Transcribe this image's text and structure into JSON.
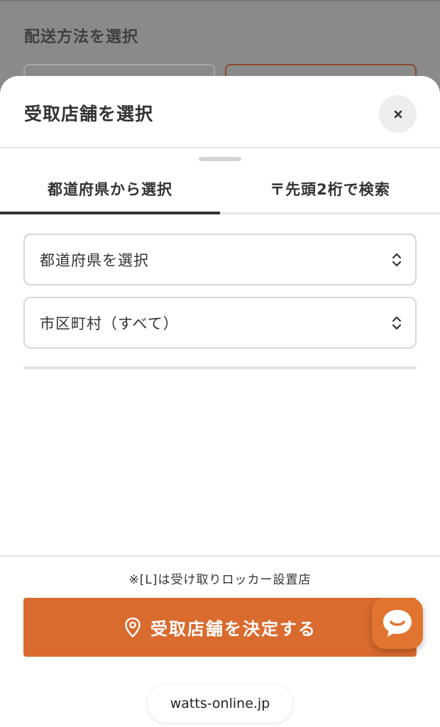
{
  "background": {
    "section_title": "配送方法を選択"
  },
  "sheet": {
    "title": "受取店舗を選択",
    "close_label": "×",
    "tabs": [
      {
        "label": "都道府県から選択",
        "active": true
      },
      {
        "label": "〒先頭2桁で検索",
        "active": false
      }
    ],
    "prefecture_select": {
      "value": "都道府県を選択"
    },
    "city_select": {
      "value": "市区町村（すべて）"
    },
    "note": "※[L]は受け取りロッカー設置店",
    "confirm_button": "受取店舗を決定する",
    "icons": {
      "confirm": "map-pin-icon",
      "select": "chevron-up-down-icon",
      "close": "close-icon",
      "chat": "chat-icon"
    }
  },
  "browser": {
    "url": "watts-online.jp"
  },
  "colors": {
    "accent": "#d96b2f",
    "chat": "#e1752f",
    "overlay": "#8a8a8a",
    "text": "#333333"
  }
}
